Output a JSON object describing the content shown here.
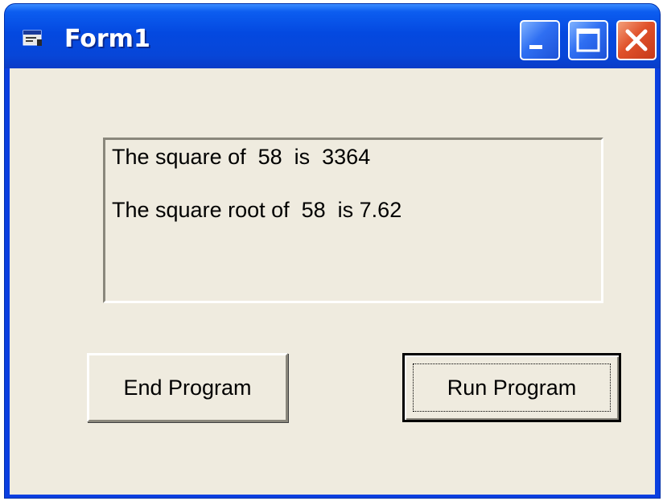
{
  "window": {
    "title": "Form1",
    "icons": {
      "app": "form-app-icon",
      "minimize": "minimize-icon",
      "maximize": "maximize-icon",
      "close": "close-icon"
    },
    "colors": {
      "titlebar": "#0449e0",
      "client": "#efebdf",
      "close_button": "#e0512a"
    }
  },
  "output": {
    "lines": [
      "The square of  58  is  3364",
      "The square root of  58  is 7.62"
    ]
  },
  "buttons": {
    "end_label": "End Program",
    "run_label": "Run Program"
  }
}
